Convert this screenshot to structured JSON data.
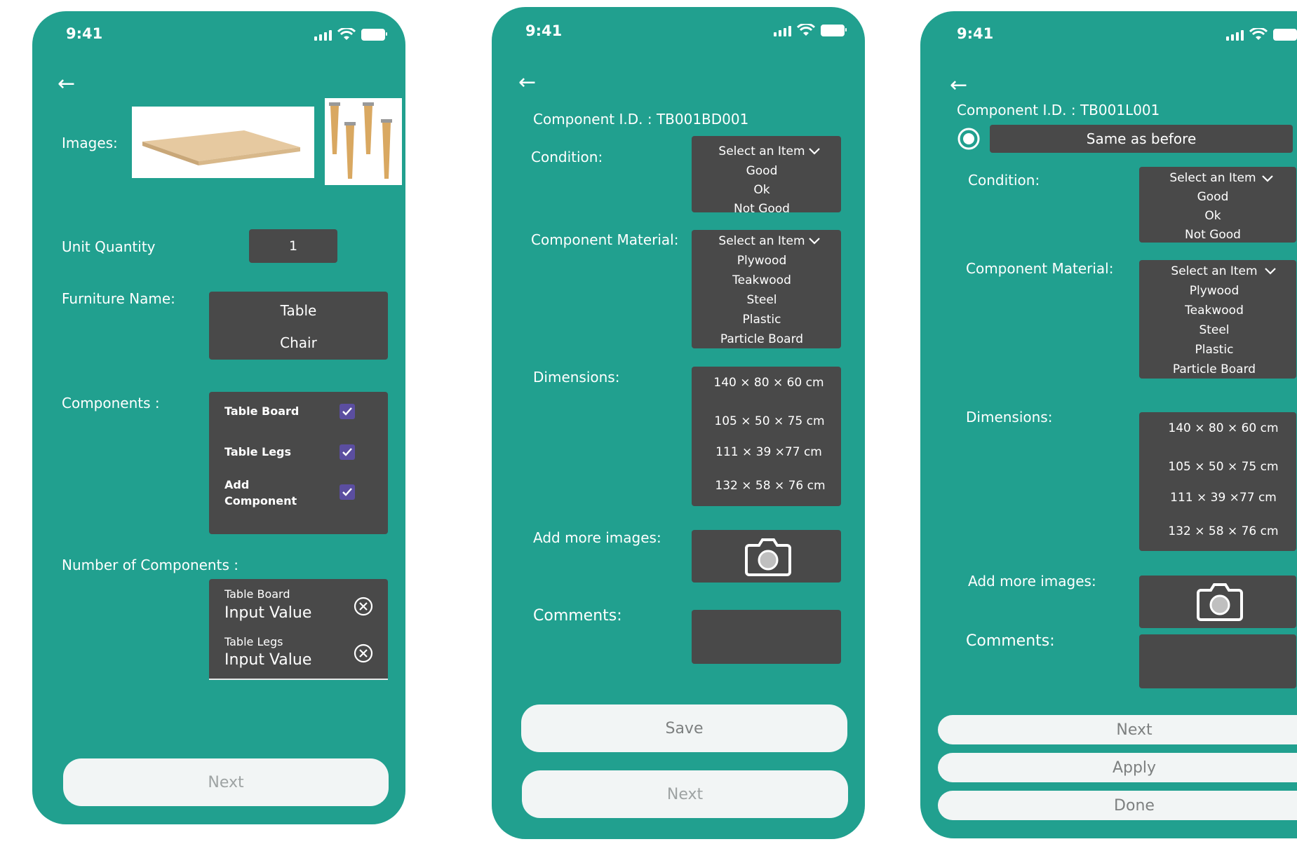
{
  "status": {
    "time": "9:41"
  },
  "screen1": {
    "images_label": "Images:",
    "unit_quantity_label": "Unit Quantity",
    "unit_quantity_value": "1",
    "furniture_name_label": "Furniture Name:",
    "furniture_options": [
      "Table",
      "Chair"
    ],
    "components_label": "Components :",
    "components": [
      "Table Board",
      "Table Legs",
      "Add Component"
    ],
    "number_components_label": "Number of Components :",
    "number_fields": [
      {
        "label": "Table Board",
        "value": "Input Value"
      },
      {
        "label": "Table Legs",
        "value": "Input Value"
      }
    ],
    "next_button": "Next"
  },
  "screen2": {
    "component_id": "Component I.D. :  TB001BD001",
    "condition_label": "Condition:",
    "select_placeholder": "Select an Item",
    "condition_options": [
      "Good",
      "Ok",
      "Not Good"
    ],
    "material_label": "Component Material:",
    "material_options": [
      "Plywood",
      "Teakwood",
      "Steel",
      "Plastic",
      "Particle Board"
    ],
    "dimensions_label": "Dimensions:",
    "dimensions": [
      "140 × 80 × 60 cm",
      "105 × 50 × 75 cm",
      "111 × 39 ×77 cm",
      "132 × 58 × 76 cm"
    ],
    "add_images_label": "Add more images:",
    "comments_label": "Comments:",
    "save_button": "Save",
    "next_button": "Next"
  },
  "screen3": {
    "component_id": "Component I.D. :  TB001L001",
    "same_as_before": "Same as before",
    "condition_label": "Condition:",
    "select_placeholder": "Select an Item",
    "condition_options": [
      "Good",
      "Ok",
      "Not Good"
    ],
    "material_label": "Component Material:",
    "material_options": [
      "Plywood",
      "Teakwood",
      "Steel",
      "Plastic",
      "Particle Board"
    ],
    "dimensions_label": "Dimensions:",
    "dimensions": [
      "140 × 80 × 60 cm",
      "105 × 50 × 75 cm",
      "111 × 39 ×77 cm",
      "132 × 58 × 76 cm"
    ],
    "add_images_label": "Add more images:",
    "comments_label": "Comments:",
    "next_button": "Next",
    "apply_button": "Apply",
    "done_button": "Done"
  },
  "icons": {
    "back": "back-arrow-icon",
    "check": "checkmark-icon",
    "clear": "clear-circle-icon",
    "camera": "camera-icon",
    "chevron": "chevron-down-icon",
    "radio": "radio-selected-icon"
  }
}
